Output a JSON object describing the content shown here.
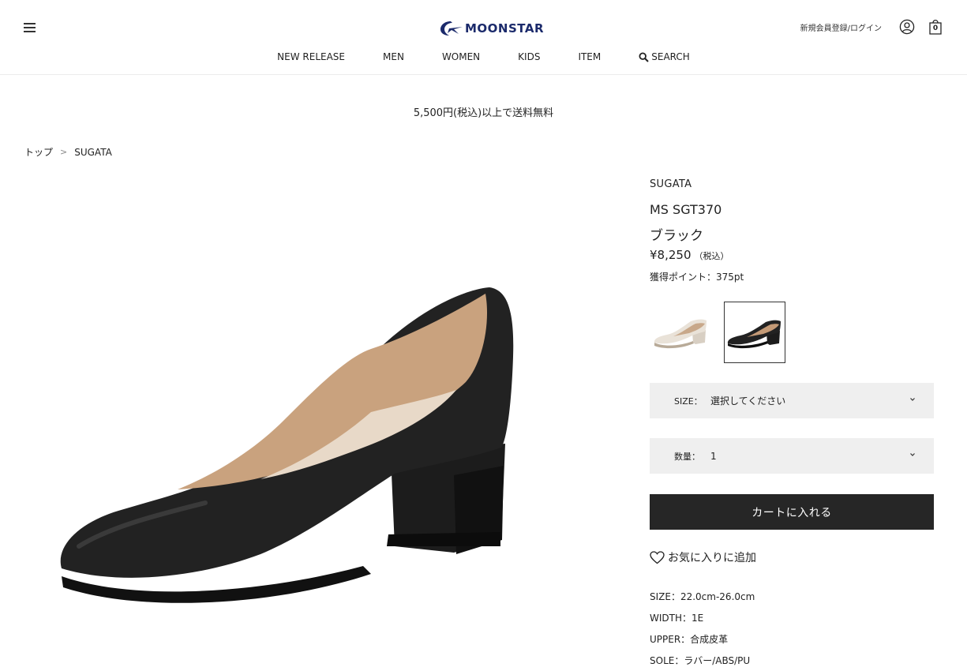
{
  "header": {
    "logo_text": "MOONSTAR",
    "login_label": "新規会員登録/ログイン",
    "cart_count": "0",
    "brand_color": "#1b2a6b"
  },
  "nav": {
    "items": [
      "NEW RELEASE",
      "MEN",
      "WOMEN",
      "KIDS",
      "ITEM"
    ],
    "search_label": "SEARCH"
  },
  "shipping_notice": "5,500円(税込)以上で送料無料",
  "breadcrumb": {
    "home": "トップ",
    "separator": ">",
    "current": "SUGATA"
  },
  "product": {
    "brand": "SUGATA",
    "model": "MS SGT370",
    "color": "ブラック",
    "price": "¥8,250",
    "tax_label": "（税込）",
    "points": "獲得ポイント：375pt",
    "swatches": [
      "ivory",
      "black"
    ],
    "selected_swatch": "black"
  },
  "size_select": {
    "label": "SIZE：",
    "value": "選択してください"
  },
  "qty_select": {
    "label": "数量：",
    "value": "1"
  },
  "cart_button_label": "カートに入れる",
  "favorite_label": "お気に入りに追加",
  "specs": [
    "SIZE：22.0cm-26.0cm",
    "WIDTH：1E",
    "UPPER：合成皮革",
    "SOLE：ラバー/ABS/PU"
  ]
}
